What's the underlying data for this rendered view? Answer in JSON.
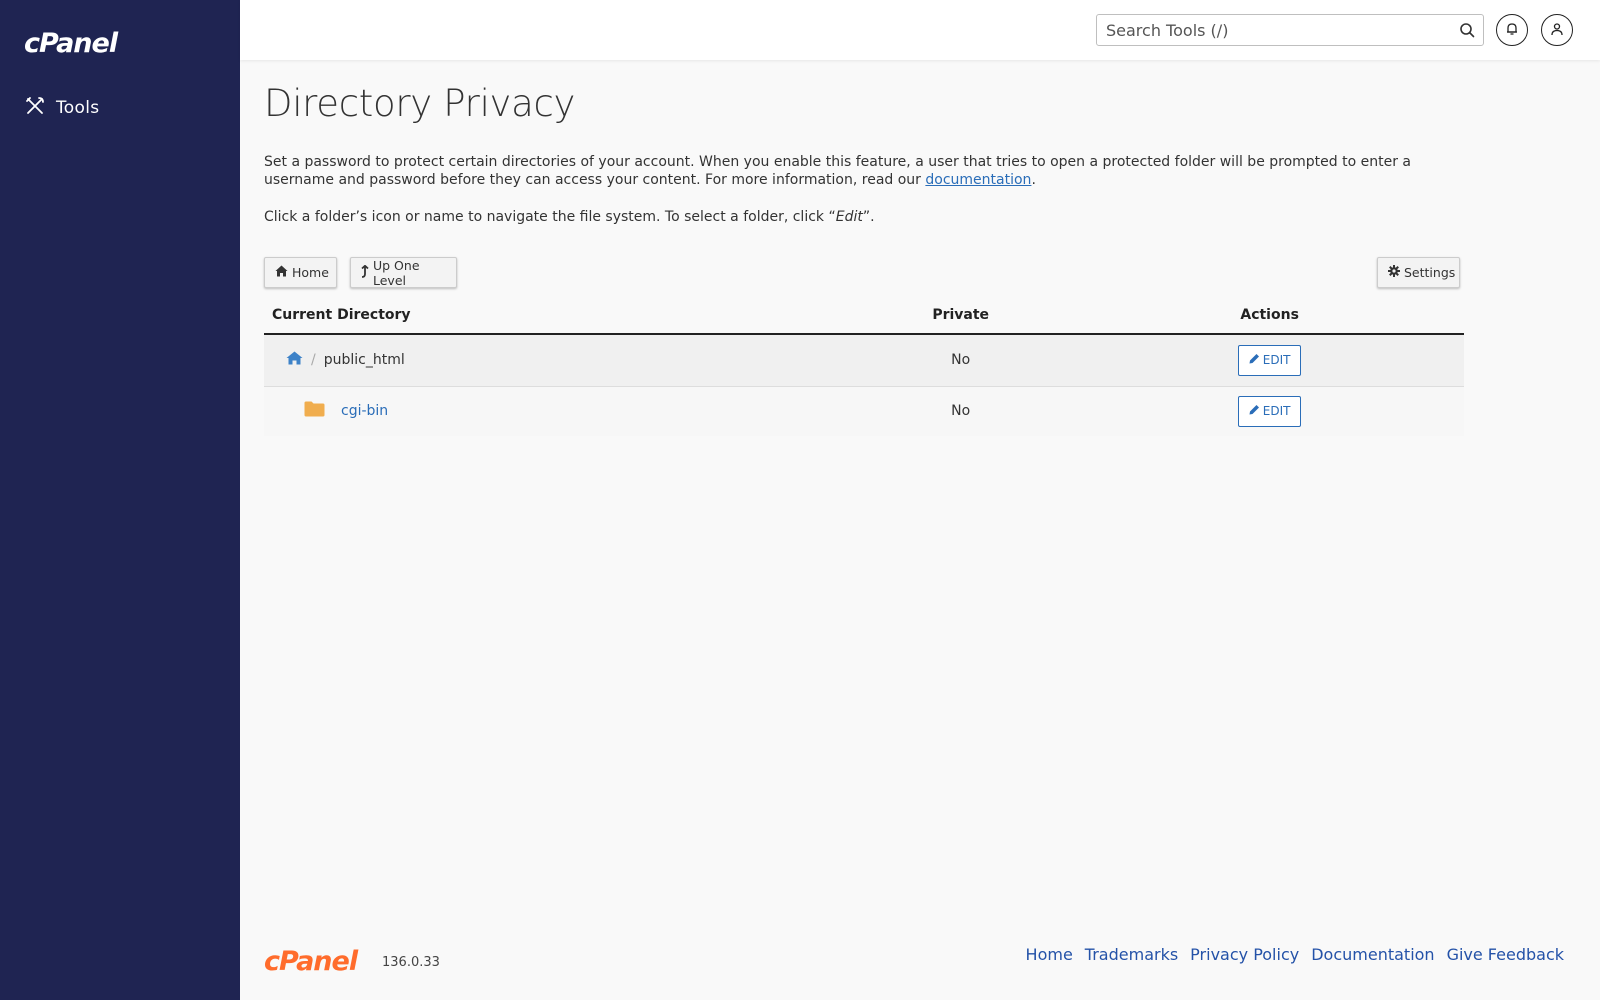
{
  "sidebar": {
    "logo": "cPanel",
    "items": [
      {
        "label": "Tools",
        "icon": "tools-icon"
      }
    ]
  },
  "header": {
    "search_placeholder": "Search Tools (/)"
  },
  "page": {
    "title": "Directory Privacy",
    "description_before_link": "Set a password to protect certain directories of your account. When you enable this feature, a user that tries to open a protected folder will be prompted to enter a username and password before they can access your content. For more information, read our ",
    "description_link": "documentation",
    "description_after_link": ".",
    "hint_before": "Click a folder’s icon or name to navigate the file system. To select a folder, click “",
    "hint_em": "Edit",
    "hint_after": "”."
  },
  "toolbar": {
    "home_label": "Home",
    "up_label": "Up One Level",
    "settings_label": "Settings"
  },
  "table": {
    "headers": [
      "Current Directory",
      "Private",
      "Actions"
    ],
    "rows": [
      {
        "name": "public_html",
        "private": "No",
        "action": "EDIT"
      },
      {
        "name": "cgi-bin",
        "private": "No",
        "action": "EDIT"
      }
    ]
  },
  "footer": {
    "logo": "cPanel",
    "version": "136.0.33",
    "links": [
      "Home",
      "Trademarks",
      "Privacy Policy",
      "Documentation",
      "Give Feedback"
    ]
  },
  "colors": {
    "sidebar_bg": "#1f2452",
    "link": "#2a6db8",
    "footer_logo": "#ff6c2c",
    "folder": "#f0ad4e"
  }
}
